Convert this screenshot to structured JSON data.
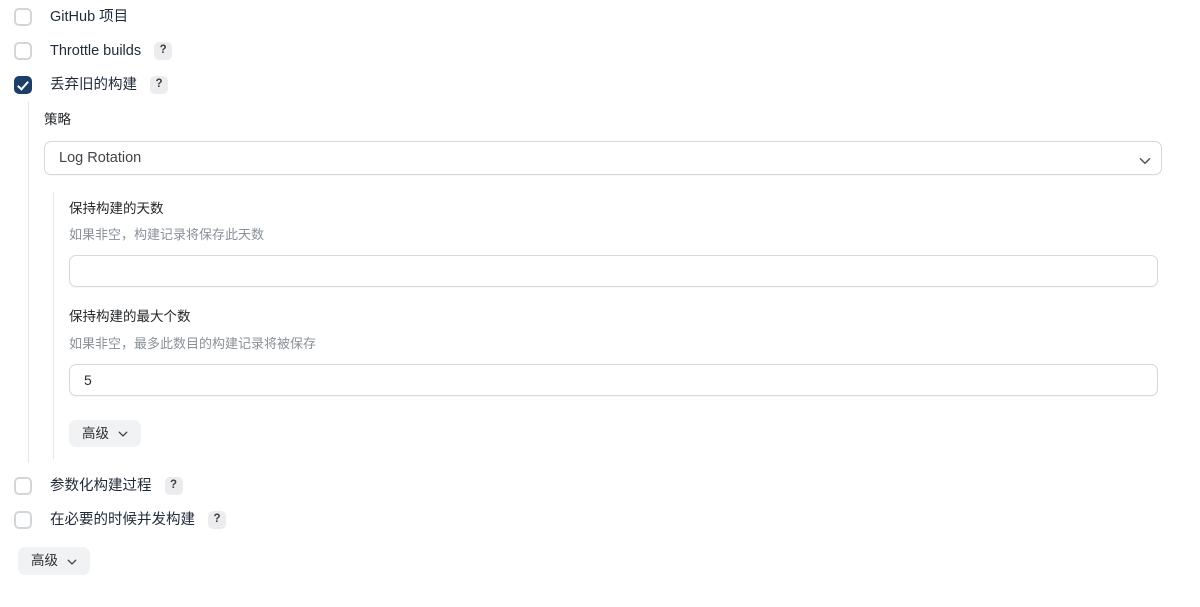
{
  "form": {
    "checkboxes_top": [
      {
        "label": "GitHub 项目",
        "checked": false,
        "help": null
      },
      {
        "label": "Throttle builds",
        "checked": false,
        "help": "?"
      },
      {
        "label": "丢弃旧的构建",
        "checked": true,
        "help": "?"
      }
    ],
    "discard_section": {
      "strategy_label": "策略",
      "strategy_value": "Log Rotation",
      "strategy_chevron_icon": "chevron-down-icon",
      "fields": [
        {
          "label": "保持构建的天数",
          "description": "如果非空，构建记录将保存此天数",
          "value": "",
          "placeholder": ""
        },
        {
          "label": "保持构建的最大个数",
          "description": "如果非空，最多此数目的构建记录将被保存",
          "value": "5",
          "placeholder": ""
        }
      ],
      "advanced_button": {
        "label": "高级",
        "chevron_icon": "chevron-down-icon"
      }
    },
    "checkboxes_bottom": [
      {
        "label": "参数化构建过程",
        "checked": false,
        "help": "?"
      },
      {
        "label": "在必要的时候并发构建",
        "checked": false,
        "help": "?"
      }
    ],
    "advanced_button_bottom": {
      "label": "高级",
      "chevron_icon": "chevron-down-icon"
    }
  },
  "colors": {
    "checkbox_checked": "#1c3f68",
    "border": "#d5d8dc",
    "guide_line": "#e4e6e8",
    "label_text": "#232629",
    "description_text": "#8a9099",
    "pill_background": "#f1f2f4",
    "help_badge_background": "#ececee"
  }
}
